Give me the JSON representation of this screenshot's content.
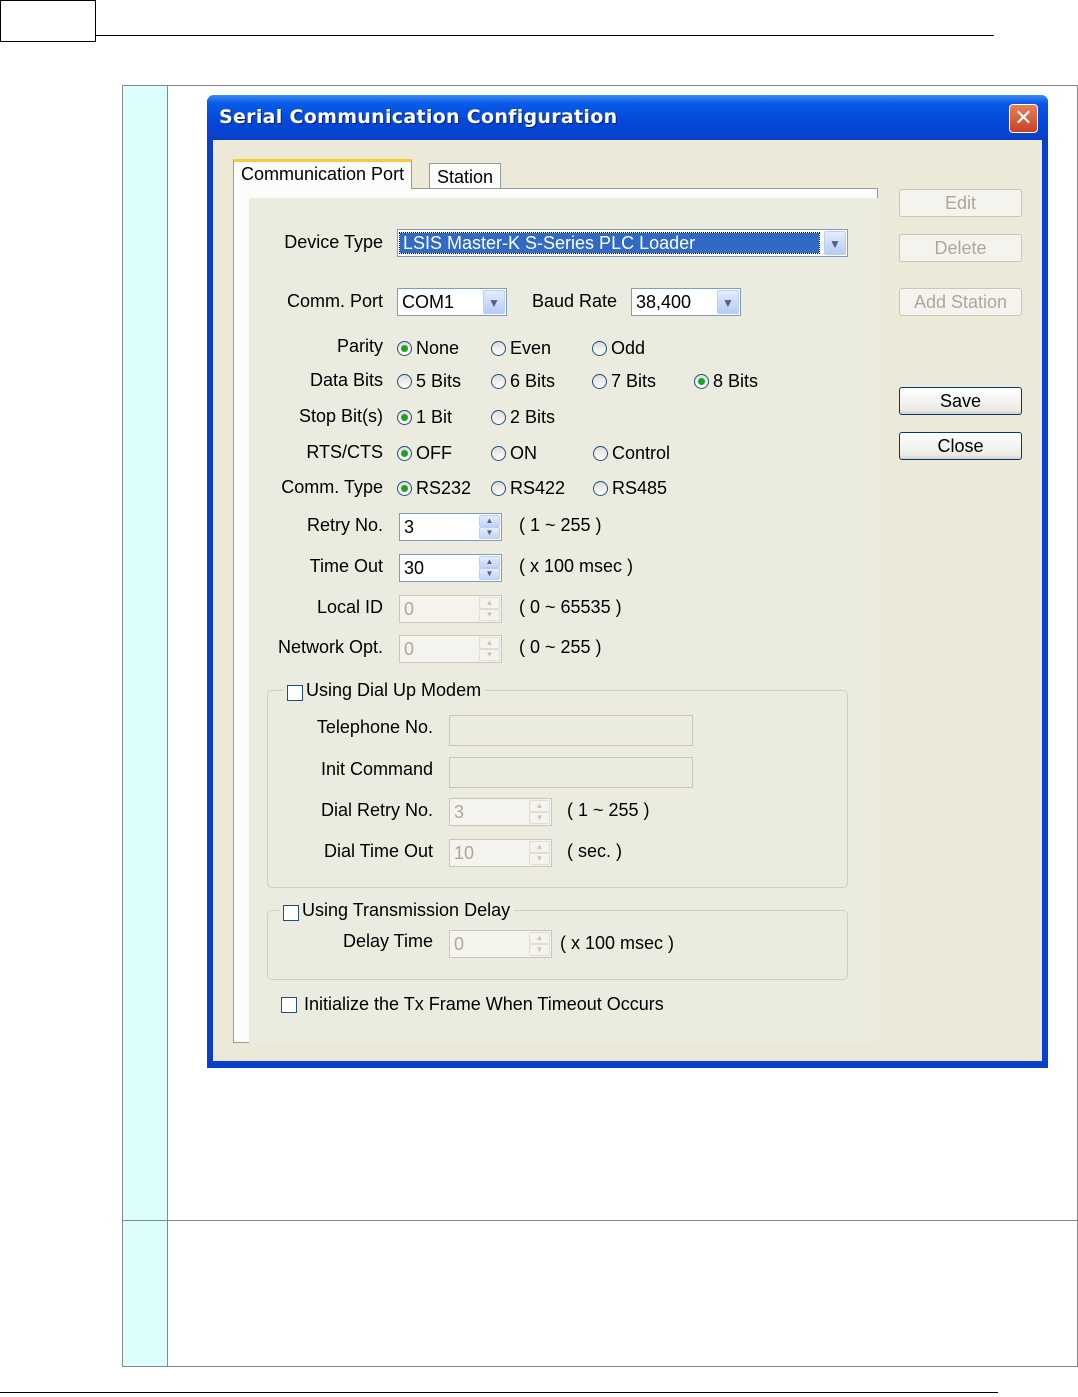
{
  "dialog": {
    "title": "Serial Communication Configuration",
    "close_glyph": "✕",
    "tabs": [
      {
        "label": "Communication Port",
        "active": true
      },
      {
        "label": "Station",
        "active": false
      }
    ],
    "buttons": {
      "edit": "Edit",
      "delete": "Delete",
      "add_station": "Add Station",
      "save": "Save",
      "close": "Close"
    },
    "device_type": {
      "label": "Device Type",
      "value": "LSIS Master-K S-Series PLC Loader"
    },
    "comm_port": {
      "label": "Comm. Port",
      "value": "COM1"
    },
    "baud_rate": {
      "label": "Baud Rate",
      "value": "38,400"
    },
    "parity": {
      "label": "Parity",
      "options": [
        "None",
        "Even",
        "Odd"
      ],
      "selected": "None"
    },
    "data_bits": {
      "label": "Data Bits",
      "options": [
        "5 Bits",
        "6 Bits",
        "7 Bits",
        "8 Bits"
      ],
      "selected": "8 Bits"
    },
    "stop_bits": {
      "label": "Stop Bit(s)",
      "options": [
        "1 Bit",
        "2 Bits"
      ],
      "selected": "1 Bit"
    },
    "rts_cts": {
      "label": "RTS/CTS",
      "options": [
        "OFF",
        "ON",
        "Control"
      ],
      "selected": "OFF"
    },
    "comm_type": {
      "label": "Comm. Type",
      "options": [
        "RS232",
        "RS422",
        "RS485"
      ],
      "selected": "RS232"
    },
    "retry_no": {
      "label": "Retry No.",
      "value": "3",
      "range": "( 1 ~ 255 )"
    },
    "time_out": {
      "label": "Time Out",
      "value": "30",
      "range": "( x 100 msec )"
    },
    "local_id": {
      "label": "Local ID",
      "value": "0",
      "range": "( 0 ~ 65535 )"
    },
    "network_opt": {
      "label": "Network Opt.",
      "value": "0",
      "range": "( 0 ~ 255 )"
    },
    "dial_up": {
      "checkbox_label": "Using Dial Up Modem",
      "checked": false,
      "telephone_label": "Telephone No.",
      "telephone_value": "",
      "init_label": "Init Command",
      "init_value": "",
      "dial_retry_label": "Dial Retry No.",
      "dial_retry_value": "3",
      "dial_retry_range": "( 1 ~ 255 )",
      "dial_timeout_label": "Dial Time Out",
      "dial_timeout_value": "10",
      "dial_timeout_range": "( sec. )"
    },
    "tx_delay": {
      "checkbox_label": "Using Transmission Delay",
      "checked": false,
      "delay_label": "Delay Time",
      "delay_value": "0",
      "delay_range": "( x 100 msec )"
    },
    "init_tx": {
      "checkbox_label": "Initialize the Tx Frame When Timeout  Occurs",
      "checked": false
    },
    "colors": {
      "title_bar": "#0448d8",
      "client": "#ece9d8",
      "radio_dot": "#21a121",
      "selection": "#316ac5"
    }
  }
}
